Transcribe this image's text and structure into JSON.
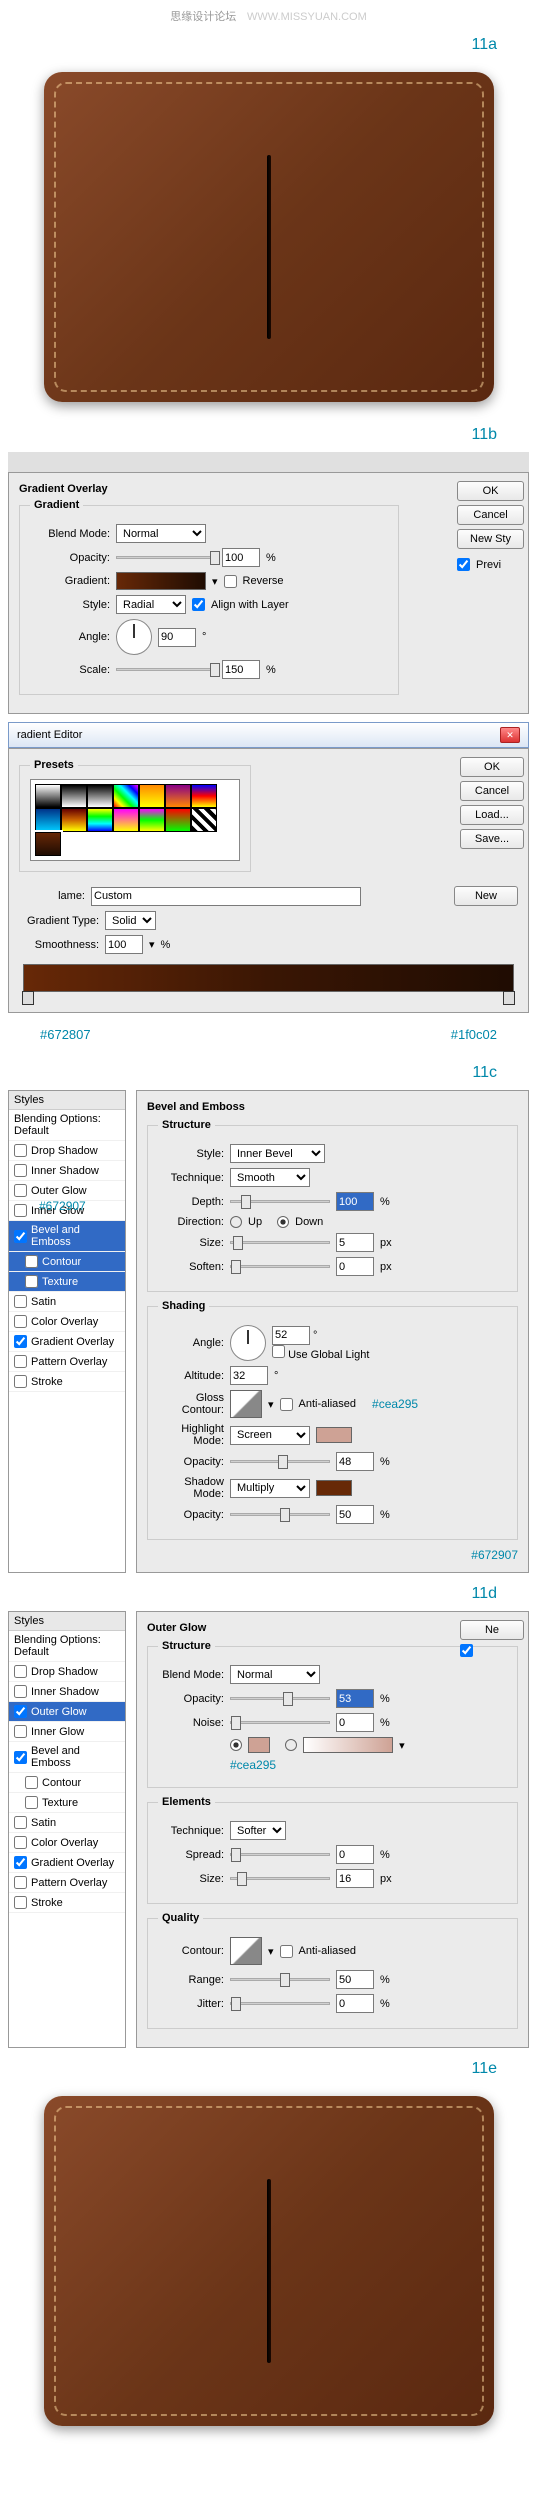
{
  "watermark": {
    "cn": "思缘设计论坛",
    "url": "WWW.MISSYUAN.COM"
  },
  "steps": {
    "a": "11a",
    "b": "11b",
    "c": "11c",
    "d": "11d",
    "e": "11e"
  },
  "hex": {
    "left": "#672807",
    "right": "#1f0c02",
    "c1": "#672907",
    "c2": "#cea295",
    "c3": "#672907",
    "c4": "#cea295"
  },
  "buttons": {
    "ok": "OK",
    "cancel": "Cancel",
    "newStyle": "New Sty",
    "preview": "Previ",
    "load": "Load...",
    "save": "Save...",
    "new": "New",
    "ne": "Ne"
  },
  "gradOverlay": {
    "title": "Gradient Overlay",
    "section": "Gradient",
    "blendMode": "Blend Mode:",
    "blendModeVal": "Normal",
    "opacity": "Opacity:",
    "opacityVal": "100",
    "pct": "%",
    "gradient": "Gradient:",
    "reverse": "Reverse",
    "style": "Style:",
    "styleVal": "Radial",
    "align": "Align with Layer",
    "angle": "Angle:",
    "angleVal": "90",
    "deg": "°",
    "scale": "Scale:",
    "scaleVal": "150"
  },
  "gradEditor": {
    "title": "radient Editor",
    "presets": "Presets",
    "name": "lame:",
    "nameVal": "Custom",
    "type": "Gradient Type:",
    "typeVal": "Solid",
    "smooth": "Smoothness:",
    "smoothVal": "100"
  },
  "stylesList": {
    "header": "Styles",
    "items": [
      "Blending Options: Default",
      "Drop Shadow",
      "Inner Shadow",
      "Outer Glow",
      "Inner Glow",
      "Bevel and Emboss",
      "Contour",
      "Texture",
      "Satin",
      "Color Overlay",
      "Gradient Overlay",
      "Pattern Overlay",
      "Stroke"
    ]
  },
  "bevel": {
    "title": "Bevel and Emboss",
    "structure": "Structure",
    "style": "Style:",
    "styleVal": "Inner Bevel",
    "technique": "Technique:",
    "techniqueVal": "Smooth",
    "depth": "Depth:",
    "depthVal": "100",
    "direction": "Direction:",
    "up": "Up",
    "down": "Down",
    "size": "Size:",
    "sizeVal": "5",
    "px": "px",
    "soften": "Soften:",
    "softenVal": "0",
    "shading": "Shading",
    "angle": "Angle:",
    "angleVal": "52",
    "useGlobal": "Use Global Light",
    "altitude": "Altitude:",
    "altitudeVal": "32",
    "glossContour": "Gloss Contour:",
    "antiAliased": "Anti-aliased",
    "highlight": "Highlight Mode:",
    "highlightVal": "Screen",
    "hOpacity": "Opacity:",
    "hOpacityVal": "48",
    "shadow": "Shadow Mode:",
    "shadowVal": "Multiply",
    "sOpacity": "Opacity:",
    "sOpacityVal": "50"
  },
  "outerGlow": {
    "title": "Outer Glow",
    "structure": "Structure",
    "blendMode": "Blend Mode:",
    "blendModeVal": "Normal",
    "opacity": "Opacity:",
    "opacityVal": "53",
    "noise": "Noise:",
    "noiseVal": "0",
    "elements": "Elements",
    "technique": "Technique:",
    "techniqueVal": "Softer",
    "spread": "Spread:",
    "spreadVal": "0",
    "size": "Size:",
    "sizeVal": "16",
    "px": "px",
    "quality": "Quality",
    "contour": "Contour:",
    "antiAliased": "Anti-aliased",
    "range": "Range:",
    "rangeVal": "50",
    "jitter": "Jitter:",
    "jitterVal": "0",
    "pct": "%"
  }
}
